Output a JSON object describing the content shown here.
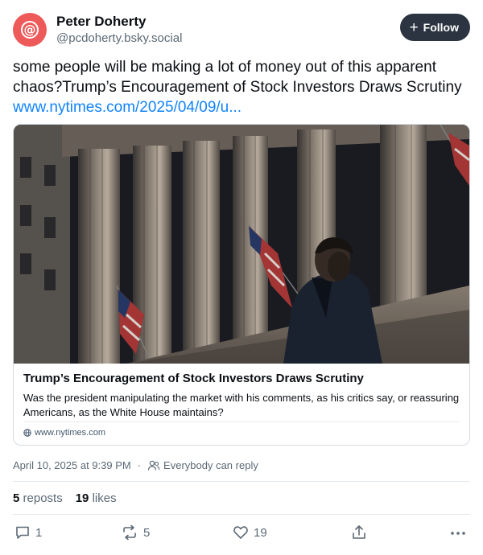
{
  "author": {
    "display_name": "Peter Doherty",
    "handle": "@pcdoherty.bsky.social",
    "avatar_color": "#ee5a5a"
  },
  "follow_label": "Follow",
  "post": {
    "text": "some people will be making a lot of money out of this apparent chaos?Trump’s Encouragement of Stock Investors Draws Scrutiny ",
    "link_text": "www.nytimes.com/2025/04/09/u..."
  },
  "link_card": {
    "title": "Trump’s Encouragement of Stock Investors Draws Scrutiny",
    "description": "Was the president manipulating the market with his comments, as his critics say, or reassuring Americans, as the White House maintains?",
    "domain": "www.nytimes.com"
  },
  "meta": {
    "timestamp": "April 10, 2025 at 9:39 PM",
    "separator": "·",
    "reply_setting": "Everybody can reply"
  },
  "stats": {
    "reposts_count": "5",
    "reposts_label": "reposts",
    "likes_count": "19",
    "likes_label": "likes"
  },
  "actions": {
    "reply_count": "1",
    "repost_count": "5",
    "like_count": "19"
  },
  "colors": {
    "link": "#1083fe",
    "follow_bg": "#2b3440",
    "muted": "#5b6975"
  }
}
